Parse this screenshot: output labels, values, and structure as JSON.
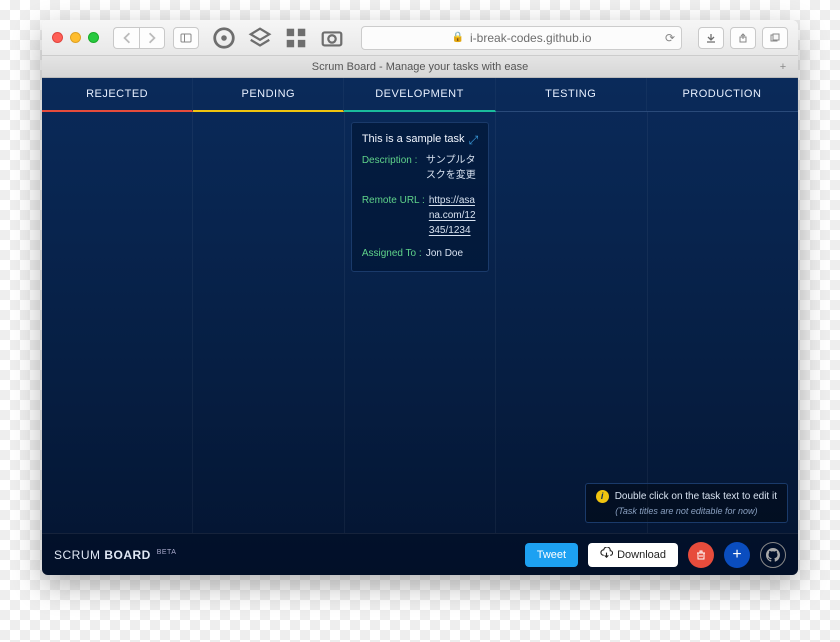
{
  "browser": {
    "url": "i-break-codes.github.io",
    "tab_title": "Scrum Board - Manage your tasks with ease"
  },
  "columns": [
    {
      "label": "REJECTED"
    },
    {
      "label": "PENDING"
    },
    {
      "label": "DEVELOPMENT"
    },
    {
      "label": "TESTING"
    },
    {
      "label": "PRODUCTION"
    }
  ],
  "task_card": {
    "title": "This is a sample task",
    "fields": {
      "description_label": "Description",
      "description_value": "サンプルタスクを変更",
      "remote_url_label": "Remote URL",
      "remote_url_value": "https://asana.com/12345/1234",
      "assigned_to_label": "Assigned To",
      "assigned_to_value": "Jon Doe"
    }
  },
  "hint": {
    "line1": "Double click on the task text to edit it",
    "line2": "(Task titles are not editable for now)"
  },
  "footer": {
    "brand_a": "SCRUM",
    "brand_b": "BOARD",
    "beta": "BETA",
    "tweet": "Tweet",
    "download": "Download"
  }
}
